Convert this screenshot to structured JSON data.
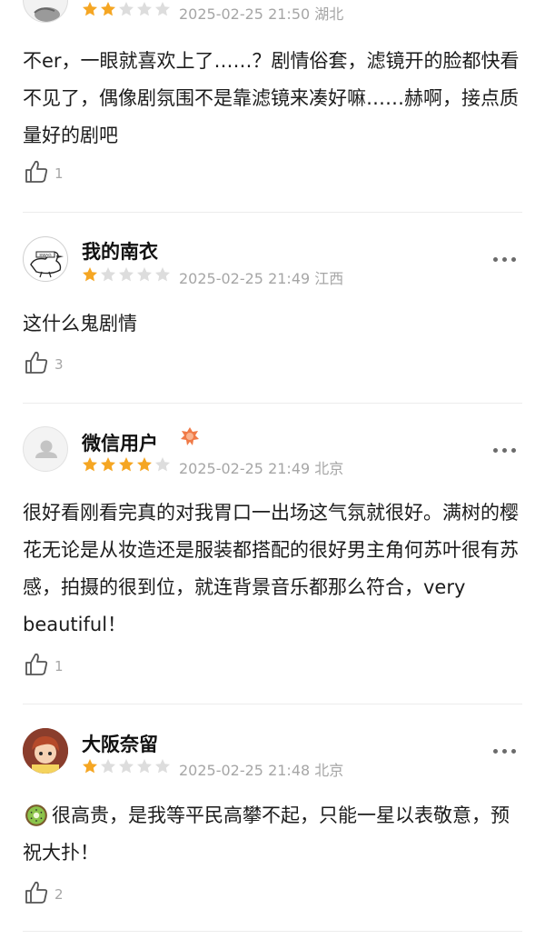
{
  "reviews": [
    {
      "username": "",
      "rating": 2,
      "datetime": "2025-02-25 21:50",
      "location": "湖北",
      "text": "不er，一眼就喜欢上了……？剧情俗套，滤镜开的脸都快看不见了，偶像剧氛围不是靠滤镜来凑好嘛……赫啊，接点质量好的剧吧",
      "likes": "1"
    },
    {
      "username": "我的南衣",
      "rating": 1,
      "datetime": "2025-02-25 21:49",
      "location": "江西",
      "text": "这什么鬼剧情",
      "likes": "3",
      "avatar_text": "SWAG"
    },
    {
      "username": "微信用户",
      "rating": 4,
      "datetime": "2025-02-25 21:49",
      "location": "北京",
      "text": "很好看刚看完真的对我胃口一出场这气氛就很好。满树的樱花无论是从妆造还是服装都搭配的很好男主角何苏叶很有苏感，拍摄的很到位，就连背景音乐都那么符合，very beautiful！",
      "likes": "1"
    },
    {
      "username": "大阪奈留",
      "rating": 1,
      "datetime": "2025-02-25 21:48",
      "location": "北京",
      "text": "很高贵，是我等平民高攀不起，只能一星以表敬意，预祝大扑！",
      "likes": "2"
    }
  ],
  "colors": {
    "star_on": "#f5a623",
    "star_off": "#dddddd",
    "meta_gray": "#a6a6a6",
    "divider": "#ececec"
  }
}
